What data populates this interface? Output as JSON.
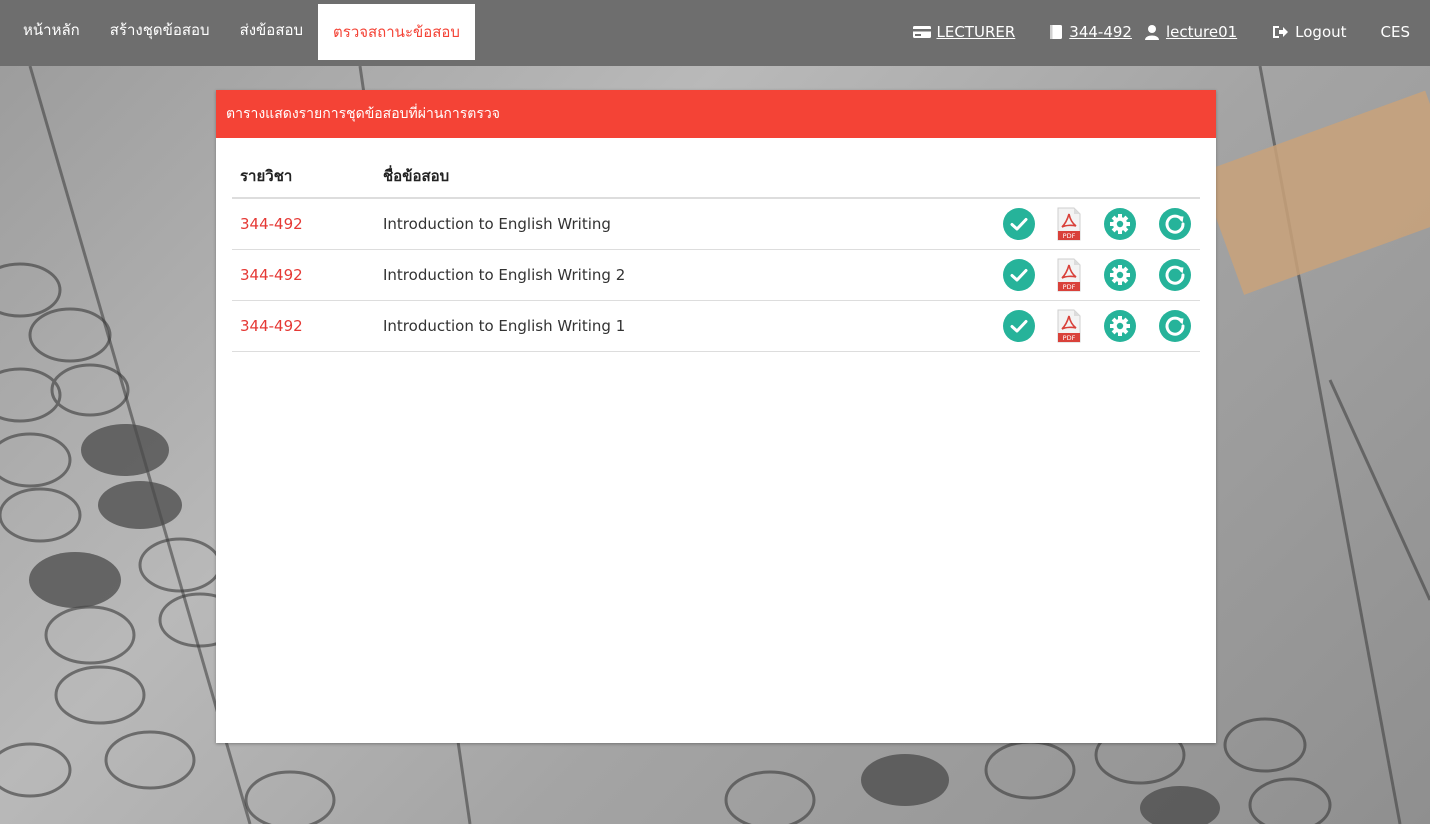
{
  "nav": {
    "items": [
      {
        "label": "หน้าหลัก",
        "active": false
      },
      {
        "label": "สร้างชุดข้อสอบ",
        "active": false
      },
      {
        "label": "ส่งข้อสอบ",
        "active": false
      },
      {
        "label": "ตรวจสถานะข้อสอบ",
        "active": true
      }
    ],
    "role": "LECTURER",
    "course": "344-492",
    "user": "lecture01",
    "logout": "Logout",
    "brand": "CES"
  },
  "card": {
    "title": "ตารางแสดงรายการชุดข้อสอบที่ผ่านการตรวจ",
    "columns": [
      "รายวิชา",
      "ชื่อข้อสอบ"
    ],
    "rows": [
      {
        "course": "344-492",
        "name": "Introduction to English Writing"
      },
      {
        "course": "344-492",
        "name": "Introduction to English Writing 2"
      },
      {
        "course": "344-492",
        "name": "Introduction to English Writing 1"
      }
    ],
    "row_actions": [
      "check-circle-icon",
      "pdf-icon",
      "gear-icon",
      "refresh-icon"
    ]
  },
  "colors": {
    "navbar": "#6e6e6e",
    "accent": "#f44336",
    "action_teal": "#26b39a",
    "course_red": "#e53935"
  }
}
